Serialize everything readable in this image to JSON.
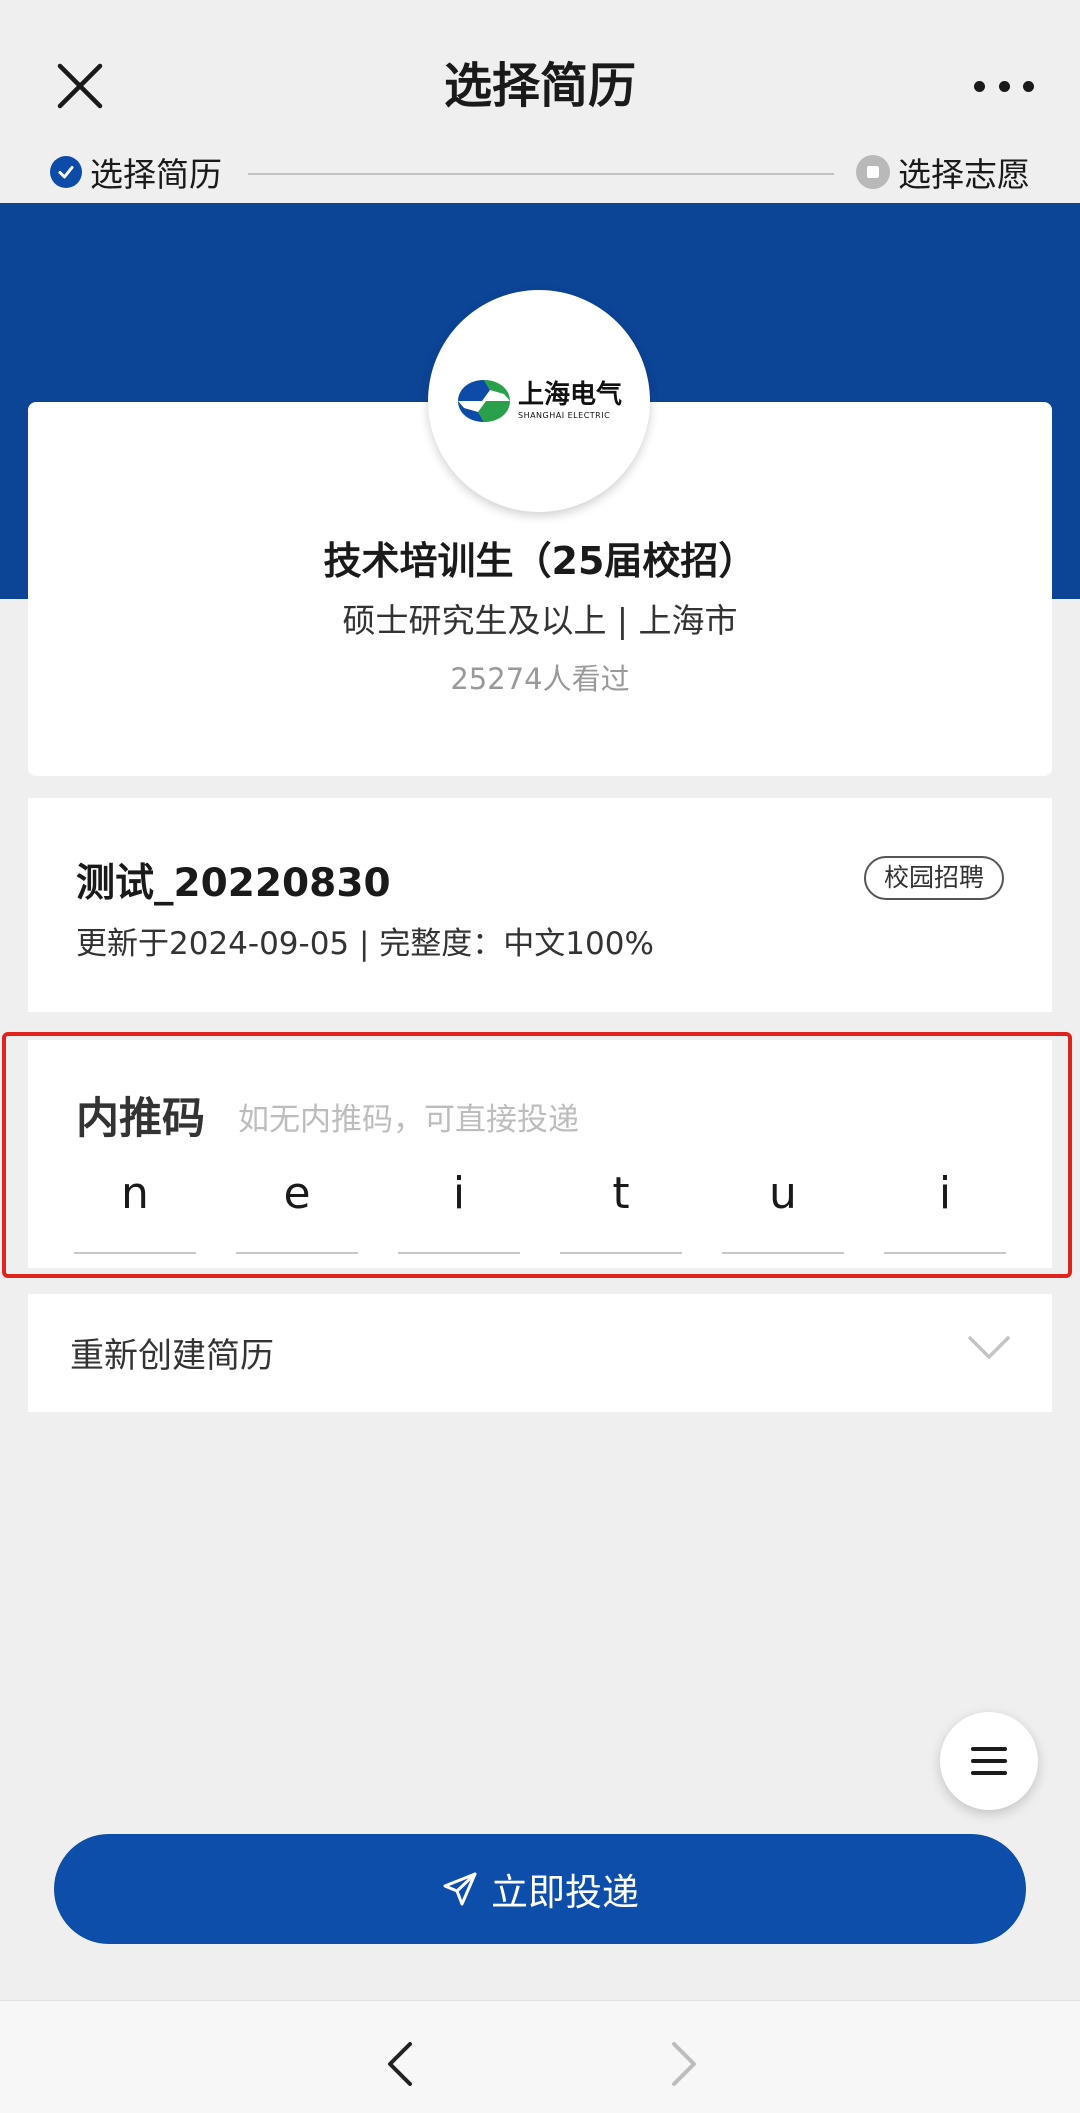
{
  "header": {
    "title": "选择简历"
  },
  "steps": [
    {
      "label": "选择简历",
      "state": "done"
    },
    {
      "label": "选择志愿",
      "state": "pending"
    }
  ],
  "job": {
    "company_logo_text": "上海电气",
    "company_logo_sub": "SHANGHAI ELECTRIC",
    "title": "技术培训生（25届校招）",
    "meta": "硕士研究生及以上 |  上海市",
    "views": "25274人看过"
  },
  "resume": {
    "name": "测试_20220830",
    "tag": "校园招聘",
    "update": "更新于2024-09-05 | 完整度：中文100%"
  },
  "referral": {
    "label": "内推码",
    "placeholder": "如无内推码，可直接投递",
    "chars": [
      "n",
      "e",
      "i",
      "t",
      "u",
      "i"
    ]
  },
  "recreate": {
    "label": "重新创建简历"
  },
  "submit": {
    "label": "立即投递"
  },
  "colors": {
    "brand_blue": "#0c4496",
    "button_blue": "#0c4eaa",
    "highlight_red": "#e0231c"
  }
}
